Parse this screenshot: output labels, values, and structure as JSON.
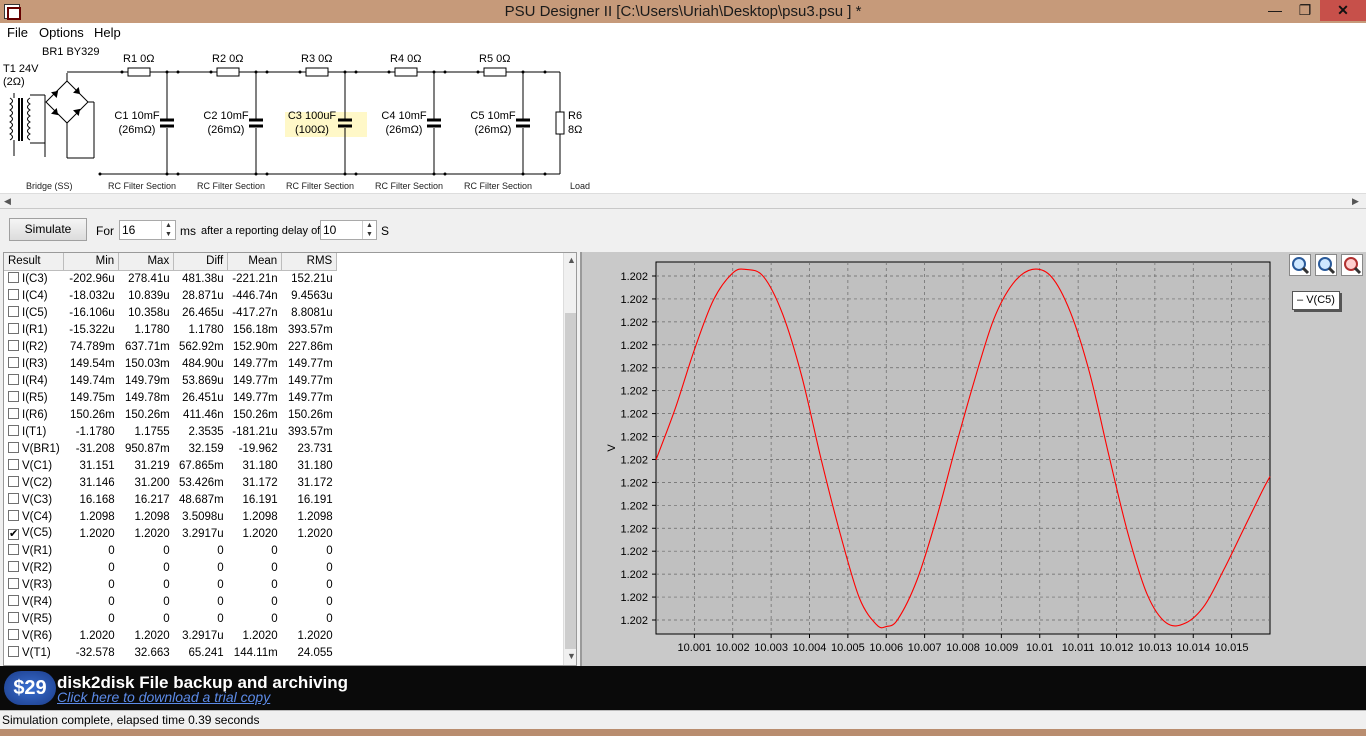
{
  "window": {
    "title": "PSU Designer II  [C:\\Users\\Uriah\\Desktop\\psu3.psu ] *",
    "min": "—",
    "max": "❐",
    "close": "✕"
  },
  "menu": [
    "File",
    "Options",
    "Help"
  ],
  "schematic": {
    "transformer": {
      "name": "T1 24V",
      "res": "(2Ω)"
    },
    "bridge": {
      "name": "BR1 BY329",
      "section": "Bridge (SS)"
    },
    "resistors": [
      "R1 0Ω",
      "R2 0Ω",
      "R3 0Ω",
      "R4 0Ω",
      "R5 0Ω"
    ],
    "capacitors": [
      {
        "name": "C1 10mF",
        "esr": "(26mΩ)"
      },
      {
        "name": "C2 10mF",
        "esr": "(26mΩ)"
      },
      {
        "name": "C3 100uF",
        "esr": "(100Ω)"
      },
      {
        "name": "C4 10mF",
        "esr": "(26mΩ)"
      },
      {
        "name": "C5 10mF",
        "esr": "(26mΩ)"
      }
    ],
    "load": {
      "name": "R6",
      "value": "8Ω",
      "section": "Load"
    },
    "section_label": "RC Filter Section"
  },
  "simulate": {
    "button": "Simulate",
    "for_label": "For",
    "ms_value": "16",
    "ms_unit": "ms",
    "delay_label": "after a reporting delay of",
    "delay_value": "10",
    "delay_unit": "S"
  },
  "results": {
    "columns": [
      "Result",
      "Min",
      "Max",
      "Diff",
      "Mean",
      "RMS"
    ],
    "rows": [
      {
        "name": "I(C3)",
        "checked": false,
        "min": "-202.96u",
        "max": "278.41u",
        "diff": "481.38u",
        "mean": "-221.21n",
        "rms": "152.21u"
      },
      {
        "name": "I(C4)",
        "checked": false,
        "min": "-18.032u",
        "max": "10.839u",
        "diff": "28.871u",
        "mean": "-446.74n",
        "rms": "9.4563u"
      },
      {
        "name": "I(C5)",
        "checked": false,
        "min": "-16.106u",
        "max": "10.358u",
        "diff": "26.465u",
        "mean": "-417.27n",
        "rms": "8.8081u"
      },
      {
        "name": "I(R1)",
        "checked": false,
        "min": "-15.322u",
        "max": "1.1780",
        "diff": "1.1780",
        "mean": "156.18m",
        "rms": "393.57m"
      },
      {
        "name": "I(R2)",
        "checked": false,
        "min": "74.789m",
        "max": "637.71m",
        "diff": "562.92m",
        "mean": "152.90m",
        "rms": "227.86m"
      },
      {
        "name": "I(R3)",
        "checked": false,
        "min": "149.54m",
        "max": "150.03m",
        "diff": "484.90u",
        "mean": "149.77m",
        "rms": "149.77m"
      },
      {
        "name": "I(R4)",
        "checked": false,
        "min": "149.74m",
        "max": "149.79m",
        "diff": "53.869u",
        "mean": "149.77m",
        "rms": "149.77m"
      },
      {
        "name": "I(R5)",
        "checked": false,
        "min": "149.75m",
        "max": "149.78m",
        "diff": "26.451u",
        "mean": "149.77m",
        "rms": "149.77m"
      },
      {
        "name": "I(R6)",
        "checked": false,
        "min": "150.26m",
        "max": "150.26m",
        "diff": "411.46n",
        "mean": "150.26m",
        "rms": "150.26m"
      },
      {
        "name": "I(T1)",
        "checked": false,
        "min": "-1.1780",
        "max": "1.1755",
        "diff": "2.3535",
        "mean": "-181.21u",
        "rms": "393.57m"
      },
      {
        "name": "V(BR1)",
        "checked": false,
        "min": "-31.208",
        "max": "950.87m",
        "diff": "32.159",
        "mean": "-19.962",
        "rms": "23.731"
      },
      {
        "name": "V(C1)",
        "checked": false,
        "min": "31.151",
        "max": "31.219",
        "diff": "67.865m",
        "mean": "31.180",
        "rms": "31.180"
      },
      {
        "name": "V(C2)",
        "checked": false,
        "min": "31.146",
        "max": "31.200",
        "diff": "53.426m",
        "mean": "31.172",
        "rms": "31.172"
      },
      {
        "name": "V(C3)",
        "checked": false,
        "min": "16.168",
        "max": "16.217",
        "diff": "48.687m",
        "mean": "16.191",
        "rms": "16.191"
      },
      {
        "name": "V(C4)",
        "checked": false,
        "min": "1.2098",
        "max": "1.2098",
        "diff": "3.5098u",
        "mean": "1.2098",
        "rms": "1.2098"
      },
      {
        "name": "V(C5)",
        "checked": true,
        "min": "1.2020",
        "max": "1.2020",
        "diff": "3.2917u",
        "mean": "1.2020",
        "rms": "1.2020"
      },
      {
        "name": "V(R1)",
        "checked": false,
        "min": "0",
        "max": "0",
        "diff": "0",
        "mean": "0",
        "rms": "0"
      },
      {
        "name": "V(R2)",
        "checked": false,
        "min": "0",
        "max": "0",
        "diff": "0",
        "mean": "0",
        "rms": "0"
      },
      {
        "name": "V(R3)",
        "checked": false,
        "min": "0",
        "max": "0",
        "diff": "0",
        "mean": "0",
        "rms": "0"
      },
      {
        "name": "V(R4)",
        "checked": false,
        "min": "0",
        "max": "0",
        "diff": "0",
        "mean": "0",
        "rms": "0"
      },
      {
        "name": "V(R5)",
        "checked": false,
        "min": "0",
        "max": "0",
        "diff": "0",
        "mean": "0",
        "rms": "0"
      },
      {
        "name": "V(R6)",
        "checked": false,
        "min": "1.2020",
        "max": "1.2020",
        "diff": "3.2917u",
        "mean": "1.2020",
        "rms": "1.2020"
      },
      {
        "name": "V(T1)",
        "checked": false,
        "min": "-32.578",
        "max": "32.663",
        "diff": "65.241",
        "mean": "144.11m",
        "rms": "24.055"
      }
    ]
  },
  "chart_data": {
    "type": "line",
    "ylabel": "V",
    "legend": [
      "V(C5)"
    ],
    "legend_placement": "top-right",
    "grid": true,
    "y_tick_labels": [
      "1.202",
      "1.202",
      "1.202",
      "1.202",
      "1.202",
      "1.202",
      "1.202",
      "1.202",
      "1.202",
      "1.202",
      "1.202",
      "1.202",
      "1.202",
      "1.202",
      "1.202",
      "1.202"
    ],
    "x_tick_labels": [
      "10.001",
      "10.002",
      "10.003",
      "10.004",
      "10.005",
      "10.006",
      "10.007",
      "10.008",
      "10.009",
      "10.01",
      "10.011",
      "10.012",
      "10.013",
      "10.014",
      "10.015"
    ],
    "xlim": [
      10.0,
      10.016
    ],
    "series": [
      {
        "name": "V(C5)",
        "color": "#ff0000",
        "x": [
          10.0,
          10.0005,
          10.001,
          10.0015,
          10.002,
          10.00235,
          10.0028,
          10.0033,
          10.0038,
          10.0043,
          10.0048,
          10.0053,
          10.00575,
          10.006,
          10.0063,
          10.0068,
          10.0073,
          10.0078,
          10.0083,
          10.0088,
          10.0093,
          10.0098,
          10.0103,
          10.0108,
          10.0113,
          10.0118,
          10.0123,
          10.0128,
          10.0133,
          10.0138,
          10.0143,
          10.0148,
          10.0153,
          10.0158,
          10.016
        ],
        "y": [
          0.467,
          0.61,
          0.775,
          0.915,
          0.99,
          1.0,
          0.98,
          0.875,
          0.7,
          0.47,
          0.26,
          0.08,
          0.005,
          0.0,
          0.02,
          0.13,
          0.3,
          0.5,
          0.69,
          0.86,
          0.96,
          1.0,
          0.98,
          0.88,
          0.71,
          0.48,
          0.26,
          0.09,
          0.01,
          0.01,
          0.06,
          0.16,
          0.27,
          0.38,
          0.42
        ]
      }
    ]
  },
  "banner": {
    "price": "$29",
    "headline": "disk2disk File backup and archiving",
    "link": "Click here to download a trial copy"
  },
  "status": "Simulation complete, elapsed time 0.39 seconds"
}
